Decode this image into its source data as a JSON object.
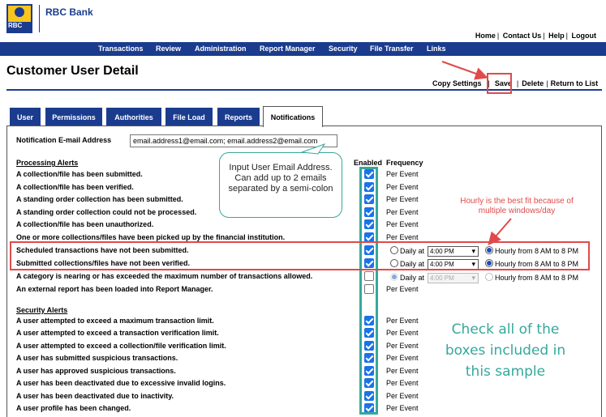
{
  "brand": {
    "logo_text": "RBC",
    "name": "RBC Bank"
  },
  "utility_links": [
    "Home",
    "Contact Us",
    "Help",
    "Logout"
  ],
  "nav": [
    "Transactions",
    "Review",
    "Administration",
    "Report Manager",
    "Security",
    "File Transfer",
    "Links"
  ],
  "page": {
    "title": "Customer User Detail"
  },
  "actions": [
    "Copy Settings",
    "Save",
    "Delete",
    "Return to List"
  ],
  "tabs": [
    "User",
    "Permissions",
    "Authorities",
    "File Load",
    "Reports",
    "Notifications"
  ],
  "active_tab": "Notifications",
  "email": {
    "label": "Notification E-mail Address",
    "value": "email.address1@email.com; email.address2@email.com"
  },
  "columns": {
    "enabled": "Enabled",
    "frequency": "Frequency"
  },
  "processing": {
    "title": "Processing Alerts",
    "rows": [
      {
        "label": "A collection/file has been submitted.",
        "enabled": true,
        "frequency": "Per Event"
      },
      {
        "label": "A collection/file has been verified.",
        "enabled": true,
        "frequency": "Per Event"
      },
      {
        "label": "A standing order collection has been submitted.",
        "enabled": true,
        "frequency": "Per Event"
      },
      {
        "label": "A standing order collection could not be processed.",
        "enabled": true,
        "frequency": "Per Event"
      },
      {
        "label": "A collection/file has been unauthorized.",
        "enabled": true,
        "frequency": "Per Event"
      },
      {
        "label": "One or more collections/files have been picked up by the financial institution.",
        "enabled": true,
        "frequency": "Per Event"
      },
      {
        "label": "Scheduled transactions have not been submitted.",
        "enabled": true,
        "daily_label": "Daily at",
        "time": "4:00 PM",
        "hourly_label": "Hourly from 8 AM to 8 PM",
        "selected": "hourly"
      },
      {
        "label": "Submitted collections/files have not been verified.",
        "enabled": true,
        "daily_label": "Daily at",
        "time": "4:00 PM",
        "hourly_label": "Hourly from 8 AM to 8 PM",
        "selected": "hourly"
      },
      {
        "label": "A category is nearing or has exceeded the maximum number of transactions allowed.",
        "enabled": false,
        "daily_label": "Daily at",
        "time": "4:00 PM",
        "hourly_label": "Hourly from 8 AM to 8 PM",
        "selected": "daily",
        "disabled": true
      },
      {
        "label": "An external report has been loaded into Report Manager.",
        "enabled": false,
        "frequency": "Per Event"
      }
    ]
  },
  "security": {
    "title": "Security Alerts",
    "rows": [
      {
        "label": "A user attempted to exceed a maximum transaction limit.",
        "enabled": true,
        "frequency": "Per Event"
      },
      {
        "label": "A user attempted to exceed a transaction verification limit.",
        "enabled": true,
        "frequency": "Per Event"
      },
      {
        "label": "A user attempted to exceed a collection/file verification limit.",
        "enabled": true,
        "frequency": "Per Event"
      },
      {
        "label": "A user has submitted suspicious transactions.",
        "enabled": true,
        "frequency": "Per Event"
      },
      {
        "label": "A user has approved suspicious transactions.",
        "enabled": true,
        "frequency": "Per Event"
      },
      {
        "label": "A user has been deactivated due to excessive invalid logins.",
        "enabled": true,
        "frequency": "Per Event"
      },
      {
        "label": "A user has been deactivated due to inactivity.",
        "enabled": true,
        "frequency": "Per Event"
      },
      {
        "label": "A user profile has been changed.",
        "enabled": true,
        "frequency": "Per Event"
      }
    ]
  },
  "annotations": {
    "callout": "Input User Email Address. Can add up to 2 emails separated by a semi-colon",
    "hourly_note": "Hourly is the best fit because of multiple windows/day",
    "check_note": "Check all of the boxes included in this sample"
  },
  "colors": {
    "navy": "#1b3c8e",
    "teal": "#35a89c",
    "red": "#e04a4a",
    "checkbox": "#1a73e8"
  }
}
